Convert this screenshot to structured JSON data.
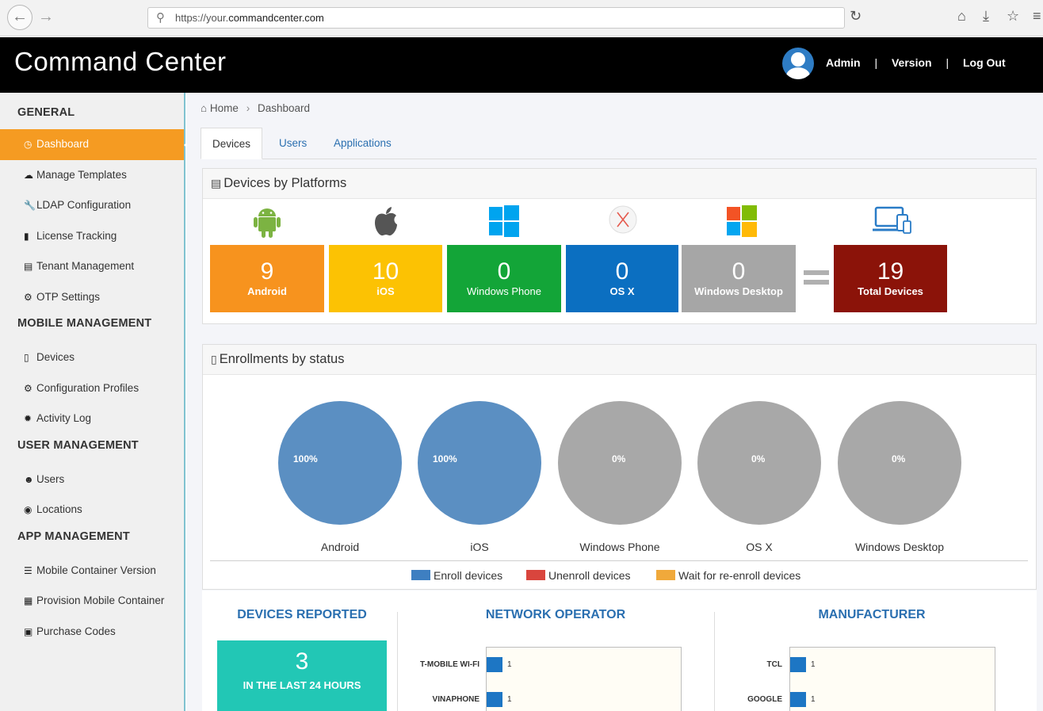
{
  "browser": {
    "url_prefix": "https://your.",
    "url_domain": "commandcenter.com"
  },
  "header": {
    "title": "Command Center",
    "links": [
      "Admin",
      "Version",
      "Log Out"
    ],
    "separator": "|"
  },
  "sidebar": {
    "sections": [
      {
        "title": "GENERAL",
        "items": [
          {
            "label": "Dashboard",
            "icon": "dashboard-icon",
            "active": true
          },
          {
            "label": "Manage Templates",
            "icon": "cloud-icon"
          },
          {
            "label": "LDAP Configuration",
            "icon": "wrench-icon"
          },
          {
            "label": "License Tracking",
            "icon": "barcode-icon"
          },
          {
            "label": "Tenant Management",
            "icon": "list-icon"
          },
          {
            "label": "OTP Settings",
            "icon": "gear-icon"
          }
        ]
      },
      {
        "title": "MOBILE MANAGEMENT",
        "items": [
          {
            "label": "Devices",
            "icon": "tablet-icon"
          },
          {
            "label": "Configuration Profiles",
            "icon": "gear-icon"
          },
          {
            "label": "Activity Log",
            "icon": "cog-icon"
          }
        ]
      },
      {
        "title": "USER MANAGEMENT",
        "items": [
          {
            "label": "Users",
            "icon": "user-icon"
          },
          {
            "label": "Locations",
            "icon": "globe-icon"
          }
        ]
      },
      {
        "title": "APP MANAGEMENT",
        "items": [
          {
            "label": "Mobile Container Version",
            "icon": "list-icon"
          },
          {
            "label": "Provision Mobile Container",
            "icon": "qrcode-icon"
          },
          {
            "label": "Purchase Codes",
            "icon": "briefcase-icon"
          }
        ]
      }
    ]
  },
  "breadcrumb": {
    "home": "Home",
    "current": "Dashboard"
  },
  "tabs": [
    "Devices",
    "Users",
    "Applications"
  ],
  "platforms_panel": {
    "title": "Devices by Platforms",
    "tiles": [
      {
        "count": "9",
        "label": "Android",
        "color": "#f7931e"
      },
      {
        "count": "10",
        "label": "iOS",
        "color": "#fcc203"
      },
      {
        "count": "0",
        "label": "Windows Phone",
        "color": "#13a538"
      },
      {
        "count": "0",
        "label": "OS X",
        "color": "#0b6fc1"
      },
      {
        "count": "0",
        "label": "Windows Desktop",
        "color": "#a6a6a6"
      }
    ],
    "total": {
      "count": "19",
      "label": "Total Devices",
      "color": "#8b1309"
    }
  },
  "enrollments_panel": {
    "title": "Enrollments by status",
    "circles": [
      {
        "label": "Android",
        "percent": "100%",
        "color": "#5b8fc2"
      },
      {
        "label": "iOS",
        "percent": "100%",
        "color": "#5b8fc2"
      },
      {
        "label": "Windows Phone",
        "percent": "0%",
        "color": "#a8a8a8"
      },
      {
        "label": "OS X",
        "percent": "0%",
        "color": "#a8a8a8"
      },
      {
        "label": "Windows Desktop",
        "percent": "0%",
        "color": "#a8a8a8"
      }
    ],
    "legend": [
      {
        "label": "Enroll devices",
        "color": "#3e7fc1"
      },
      {
        "label": "Unenroll devices",
        "color": "#d9453d"
      },
      {
        "label": "Wait for re-enroll devices",
        "color": "#f0a93b"
      }
    ]
  },
  "devices_reported": {
    "title": "DEVICES REPORTED",
    "count": "3",
    "caption": "IN THE LAST 24 HOURS"
  },
  "network_operator": {
    "title": "NETWORK OPERATOR",
    "bars": [
      {
        "label": "T-MOBILE WI-FI",
        "value": "1"
      },
      {
        "label": "VINAPHONE",
        "value": "1"
      }
    ]
  },
  "manufacturer": {
    "title": "MANUFACTURER",
    "bars": [
      {
        "label": "TCL",
        "value": "1"
      },
      {
        "label": "GOOGLE",
        "value": "1"
      }
    ]
  }
}
